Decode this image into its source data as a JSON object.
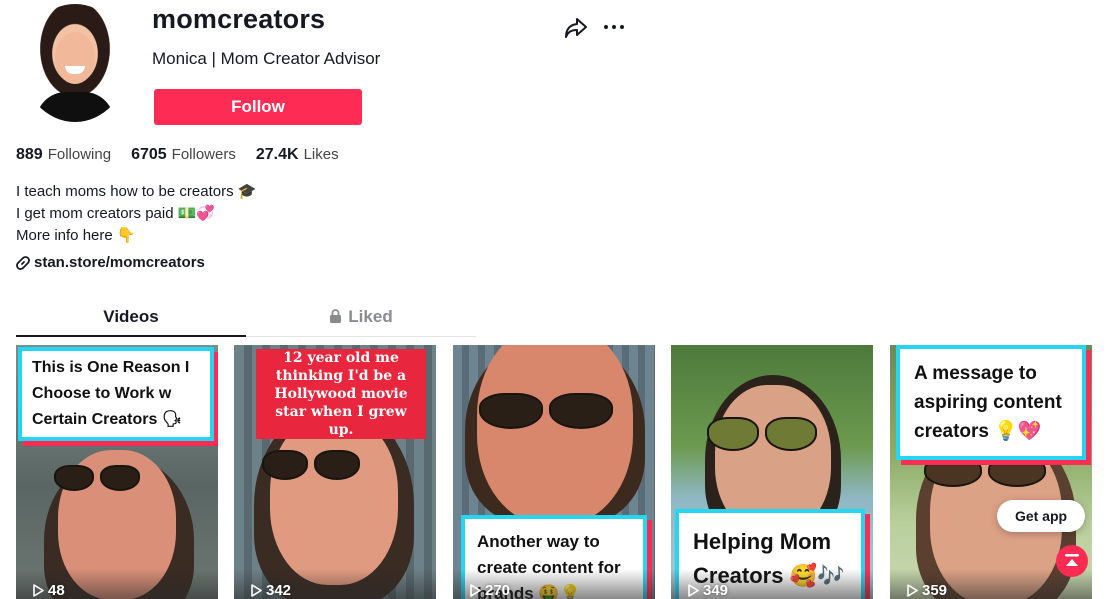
{
  "profile": {
    "username": "momcreators",
    "nickname": "Monica | Mom Creator Advisor",
    "follow_label": "Follow"
  },
  "stats": [
    {
      "value": "889",
      "label": "Following"
    },
    {
      "value": "6705",
      "label": "Followers"
    },
    {
      "value": "27.4K",
      "label": "Likes"
    }
  ],
  "bio": {
    "line1": "I teach moms how to be creators 🎓",
    "line2": "I get mom creators paid 💵💞",
    "line3": "More info here 👇",
    "link": "stan.store/momcreators"
  },
  "tabs": [
    {
      "label": "Videos",
      "active": true
    },
    {
      "label": "Liked",
      "active": false
    }
  ],
  "videos": [
    {
      "caption": "This is One Reason I Choose to Work w Certain Creators 🗣",
      "views": "48"
    },
    {
      "caption": "12 year old me thinking I'd be a Hollywood movie star when I grew up.",
      "views": "342"
    },
    {
      "caption": "Another way to create content for brands 🤑💡",
      "views": "270"
    },
    {
      "caption": "Helping Mom Creators 🥰🎶",
      "views": "349"
    },
    {
      "caption": "A message to aspiring content creators 💡💖",
      "views": "359"
    }
  ],
  "overlays": {
    "get_app": "Get app"
  },
  "colors": {
    "accent": "#fe2c55",
    "caption_border": "#25d6f3"
  }
}
